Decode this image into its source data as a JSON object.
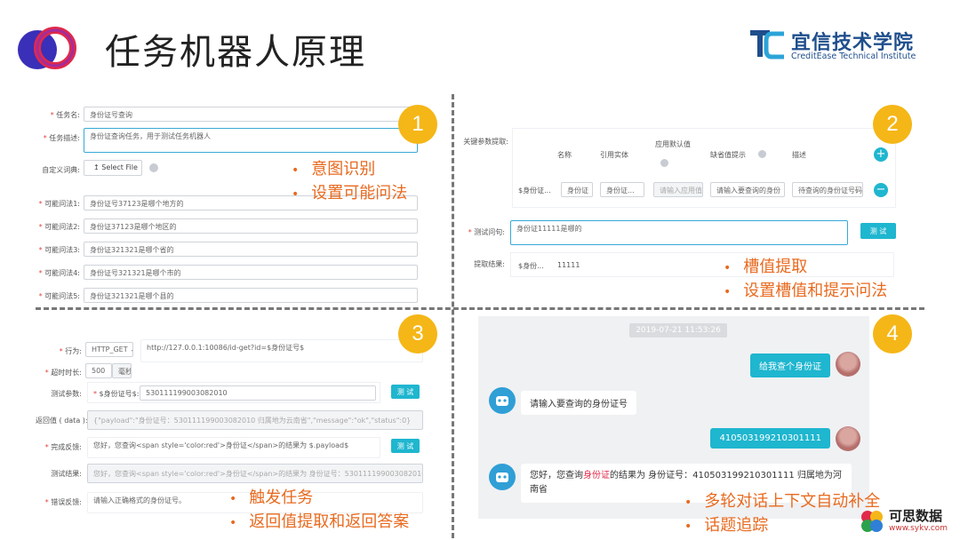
{
  "title": "任务机器人原理",
  "brand": {
    "cn": "宜信技术学院",
    "en": "CreditEase Technical Institute"
  },
  "q1": {
    "badge": "1",
    "fields": [
      {
        "label": "任务名:",
        "value": "身份证号查询",
        "required": true
      },
      {
        "label": "任务描述:",
        "value": "身份证查询任务，用于测试任务机器人",
        "required": true
      },
      {
        "label": "自定义词典:",
        "value": "Select File",
        "required": false
      },
      {
        "label": "可能问法1:",
        "value": "身份证号37123是哪个地方的",
        "required": true
      },
      {
        "label": "可能问法2:",
        "value": "身份证37123是哪个地区的",
        "required": true
      },
      {
        "label": "可能问法3:",
        "value": "身份证321321是哪个省的",
        "required": true
      },
      {
        "label": "可能问法4:",
        "value": "身份证号321321是哪个市的",
        "required": true
      },
      {
        "label": "可能问法5:",
        "value": "身份证321321是哪个县的",
        "required": true
      }
    ],
    "bullets": [
      "意图识别",
      "设置可能问法"
    ]
  },
  "q2": {
    "badge": "2",
    "key_label": "关键参数提取:",
    "headers": [
      "名称",
      "引用实体",
      "应用默认值",
      "缺省值提示",
      "描述"
    ],
    "row": [
      "$身份证...",
      "身份证",
      "身份证...",
      "请输入应用值",
      "请输入要查询的身份",
      "待查询的身份证号码"
    ],
    "test_label": "测试问句:",
    "test_value": "身份证11111是哪的",
    "test_button": "测 试",
    "result_label": "提取结果:",
    "result_key": "$身份...",
    "result_value": "11111",
    "bullets": [
      "槽值提取",
      "设置槽值和提示问法"
    ]
  },
  "q3": {
    "badge": "3",
    "action_label": "行为:",
    "action_value": "HTTP_GET",
    "url": "http://127.0.0.1:10086/id-get?id=$身份证号$",
    "timeout_label": "超时时长:",
    "timeout_value": "500",
    "timeout_unit": "毫秒",
    "test_param_label": "测试参数:",
    "param_key": "$身份证号$:",
    "param_value": "530111199003082010",
    "test_button": "测 试",
    "return_label": "返回值 ( data ):",
    "return_value": "{\"payload\":\"身份证号：530111199003082010 归属地为云南省\",\"message\":\"ok\",\"status\":0}",
    "reply_label": "完成反馈:",
    "reply_value": "您好，您查询<span style='color:red'>身份证</span>的结果为 $.payload$",
    "reply_button": "测 试",
    "result_label": "测试结果:",
    "result_value": "您好，您查询<span style='color:red'>身份证</span>的结果为 身份证号：530111199003082010 归属地为云南省",
    "error_label": "错误反馈:",
    "error_value": "请输入正确格式的身份证号。",
    "bullets": [
      "触发任务",
      "返回值提取和返回答案"
    ]
  },
  "q4": {
    "badge": "4",
    "timestamp": "2019-07-21 11:53:26",
    "msg1": "给我查个身份证",
    "msg2": "请输入要查询的身份证号",
    "msg3": "410503199210301111",
    "msg4_pre": "您好，您查询",
    "msg4_hl": "身份证",
    "msg4_post": "的结果为 身份证号：410503199210301111 归属地为河南省",
    "bullets": [
      "多轮对话上下文自动补全",
      "话题追踪"
    ]
  },
  "watermark": {
    "cn": "可思数据",
    "url": "www.sykv.com"
  },
  "colors": {
    "accent": "#e86a1f",
    "badge": "#f5b617",
    "teal": "#1fb6cf",
    "brand": "#1f4e8c"
  }
}
